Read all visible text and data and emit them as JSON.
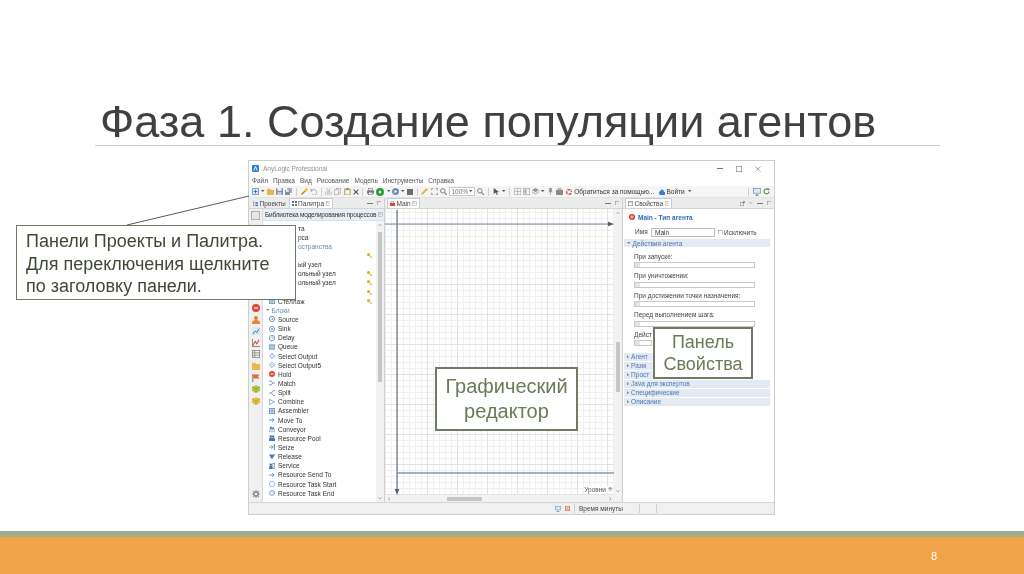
{
  "slide": {
    "title": "Фаза 1. Создание популяции агентов",
    "page_number": "8"
  },
  "window": {
    "title": "AnyLogic Professional",
    "menu": [
      "Файл",
      "Правка",
      "Вид",
      "Рисование",
      "Модель",
      "Инструменты",
      "Справка"
    ],
    "toolbar": {
      "zoom": "100%",
      "help_button": "Обратиться за помощью...",
      "login_button": "Войти"
    },
    "status_bar": "Время минуты"
  },
  "palette_panel": {
    "tabs": [
      {
        "label": "Проекты",
        "selected": false
      },
      {
        "label": "Палитра",
        "selected": true
      }
    ],
    "library": "Библиотека моделирования процессов",
    "rows": [
      {
        "kind": "part",
        "text": "та",
        "badge": false
      },
      {
        "kind": "part",
        "text": "рса",
        "badge": false
      },
      {
        "kind": "parthead",
        "text": "остранства"
      },
      {
        "kind": "part",
        "badge": true
      },
      {
        "kind": "part",
        "text": "ый узел",
        "badge": false
      },
      {
        "kind": "part",
        "text": "ольный узел",
        "badge": true
      },
      {
        "kind": "part",
        "text": "ольный узел",
        "badge": true
      },
      {
        "kind": "part",
        "badge": true
      },
      {
        "kind": "item",
        "text": "Стеллаж",
        "badge": true
      },
      {
        "kind": "head",
        "text": "Блоки",
        "expanded": true
      },
      {
        "kind": "item",
        "text": "Source",
        "badge": false
      },
      {
        "kind": "item",
        "text": "Sink",
        "badge": false
      },
      {
        "kind": "item",
        "text": "Delay",
        "badge": false
      },
      {
        "kind": "item",
        "text": "Queue",
        "badge": false
      },
      {
        "kind": "item",
        "text": "Select Output",
        "badge": false
      },
      {
        "kind": "item",
        "text": "Select Output5",
        "badge": false
      },
      {
        "kind": "item",
        "text": "Hold",
        "badge": false
      },
      {
        "kind": "item",
        "text": "Match",
        "badge": false
      },
      {
        "kind": "item",
        "text": "Split",
        "badge": false
      },
      {
        "kind": "item",
        "text": "Combine",
        "badge": false
      },
      {
        "kind": "item",
        "text": "Assembler",
        "badge": false
      },
      {
        "kind": "item",
        "text": "Move To",
        "badge": false
      },
      {
        "kind": "item",
        "text": "Conveyor",
        "badge": false
      },
      {
        "kind": "item",
        "text": "Resource Pool",
        "badge": false
      },
      {
        "kind": "item",
        "text": "Seize",
        "badge": false
      },
      {
        "kind": "item",
        "text": "Release",
        "badge": false
      },
      {
        "kind": "item",
        "text": "Service",
        "badge": false
      },
      {
        "kind": "item",
        "text": "Resource Send To",
        "badge": false
      },
      {
        "kind": "item",
        "text": "Resource Task Start",
        "badge": false
      },
      {
        "kind": "item",
        "text": "Resource Task End",
        "badge": false
      }
    ]
  },
  "editor": {
    "tabs": [
      {
        "label": "Main",
        "selected": true
      }
    ],
    "levels_button": "Уровни"
  },
  "properties_panel": {
    "tabs": [
      {
        "label": "Свойства",
        "selected": true
      }
    ],
    "heading": "Main - Тип агента",
    "name": {
      "label": "Имя",
      "value": "Main"
    },
    "exclude": {
      "label": "Исключить",
      "checked": false
    },
    "sections": [
      {
        "title": "Действия агента",
        "expanded": true,
        "kind": "full",
        "fields": [
          {
            "label": "При запуске:",
            "kind": "full"
          },
          {
            "label": "При уничтожении:",
            "kind": "full"
          },
          {
            "label": "При достижении точки назначения:",
            "kind": "full"
          },
          {
            "label": "Перед выполнением шага:",
            "kind": "full"
          },
          {
            "label": "Дейст",
            "kind": "cut"
          }
        ]
      },
      {
        "title": "Агент",
        "expanded": false,
        "kind": "cut"
      },
      {
        "title": "Разм",
        "expanded": false,
        "kind": "cut"
      },
      {
        "title": "Прост",
        "expanded": false,
        "kind": "cut"
      },
      {
        "title": "Java для экспертов",
        "expanded": false,
        "kind": "full"
      },
      {
        "title": "Специфические",
        "expanded": false,
        "kind": "full"
      },
      {
        "title": "Описание",
        "expanded": false,
        "kind": "full"
      }
    ]
  },
  "callouts": [
    {
      "text": "Панели Проекты и Палитра.\nДля переключения щелкните\nпо заголовку панели."
    },
    {
      "text": "Графический\nредактор"
    },
    {
      "text": "Панель\nСвойства"
    }
  ]
}
